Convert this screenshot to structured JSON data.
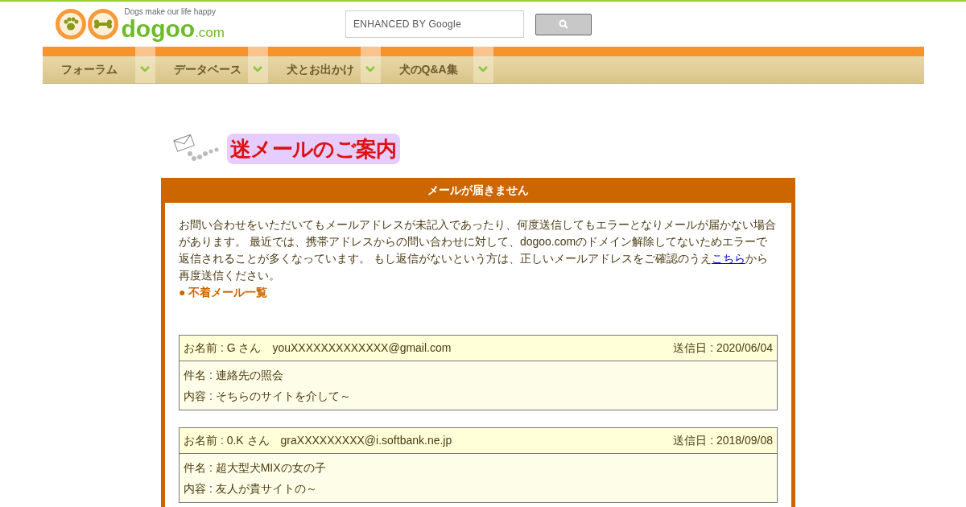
{
  "logo": {
    "tagline": "Dogs make our life happy",
    "name": "dogoo",
    "suffix": ".com"
  },
  "search": {
    "placeholder": "ENHANCED BY Google"
  },
  "nav": [
    {
      "label": "フォーラム"
    },
    {
      "label": "データベース"
    },
    {
      "label": "犬とお出かけ"
    },
    {
      "label": "犬のQ&A集"
    }
  ],
  "heading": "迷メールのご案内",
  "panel": {
    "title": "メールが届きません",
    "intro_before": "お問い合わせをいただいてもメールアドレスが未記入であったり、何度送信してもエラーとなりメールが届かない場合があります。 最近では、携帯アドレスからの問い合わせに対して、dogoo.comのドメイン解除してないためエラーで返信されることが多くなっています。 もし返信がないという方は、正しいメールアドレスをご確認のうえ",
    "link": "こちら",
    "intro_after": "から再度送信ください。",
    "list_title": "● 不着メール一覧"
  },
  "messages": [
    {
      "name": "お名前 : G さん",
      "email": "youXXXXXXXXXXXXX@gmail.com",
      "date": "送信日 : 2020/06/04",
      "subject": "件名 : 連絡先の照会",
      "content": "内容 : そちらのサイトを介して～"
    },
    {
      "name": "お名前 : 0.K さん",
      "email": "graXXXXXXXXX@i.softbank.ne.jp",
      "date": "送信日 : 2018/09/08",
      "subject": "件名 : 超大型犬MIXの女の子",
      "content": "内容 : 友人が貴サイトの～"
    }
  ]
}
